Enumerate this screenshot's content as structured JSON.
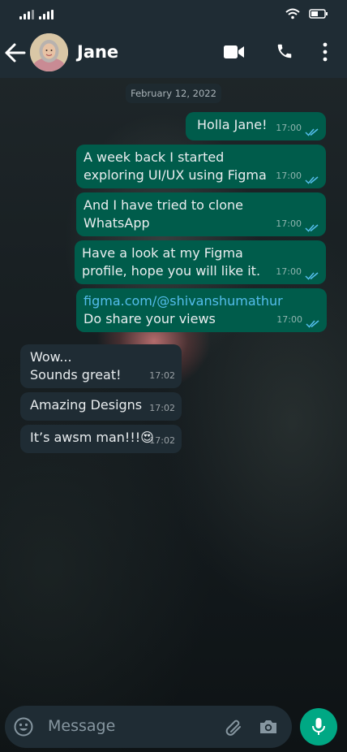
{
  "colors": {
    "header": "#1f2c34",
    "outgoing_bubble": "#005c4b",
    "incoming_bubble": "#1f2c34",
    "link": "#53bdeb",
    "accent": "#00a884",
    "read_ticks": "#53bdeb"
  },
  "status_bar": {
    "icons": [
      "signal-icon",
      "signal-icon",
      "wifi-icon",
      "battery-icon"
    ]
  },
  "header": {
    "contact_name": "Jane",
    "icons": [
      "back-arrow-icon",
      "avatar",
      "video-call-icon",
      "phone-call-icon",
      "more-options-icon"
    ]
  },
  "chat": {
    "date_label": "February 12, 2022",
    "messages": [
      {
        "direction": "out",
        "text": "Holla Jane!",
        "time": "17:00",
        "status": "read"
      },
      {
        "direction": "out",
        "text": "A week back I started\nexploring UI/UX using Figma",
        "time": "17:00",
        "status": "read"
      },
      {
        "direction": "out",
        "text": "And I have tried to clone\nWhatsApp",
        "time": "17:00",
        "status": "read"
      },
      {
        "direction": "out",
        "text": "Have a look at my Figma\nprofile, hope you will like it.",
        "time": "17:00",
        "status": "read"
      },
      {
        "direction": "out",
        "link": "figma.com/@shivanshumathur",
        "text": "Do share your views",
        "time": "17:00",
        "status": "read"
      },
      {
        "direction": "in",
        "text": "Wow...\nSounds great!",
        "time": "17:02"
      },
      {
        "direction": "in",
        "text": "Amazing Designs",
        "time": "17:02"
      },
      {
        "direction": "in",
        "text": "It’s awsm man!!!😍",
        "time": "17:02"
      }
    ]
  },
  "composer": {
    "placeholder": "Message",
    "icons": [
      "emoji-icon",
      "attach-icon",
      "camera-icon",
      "mic-icon"
    ]
  }
}
